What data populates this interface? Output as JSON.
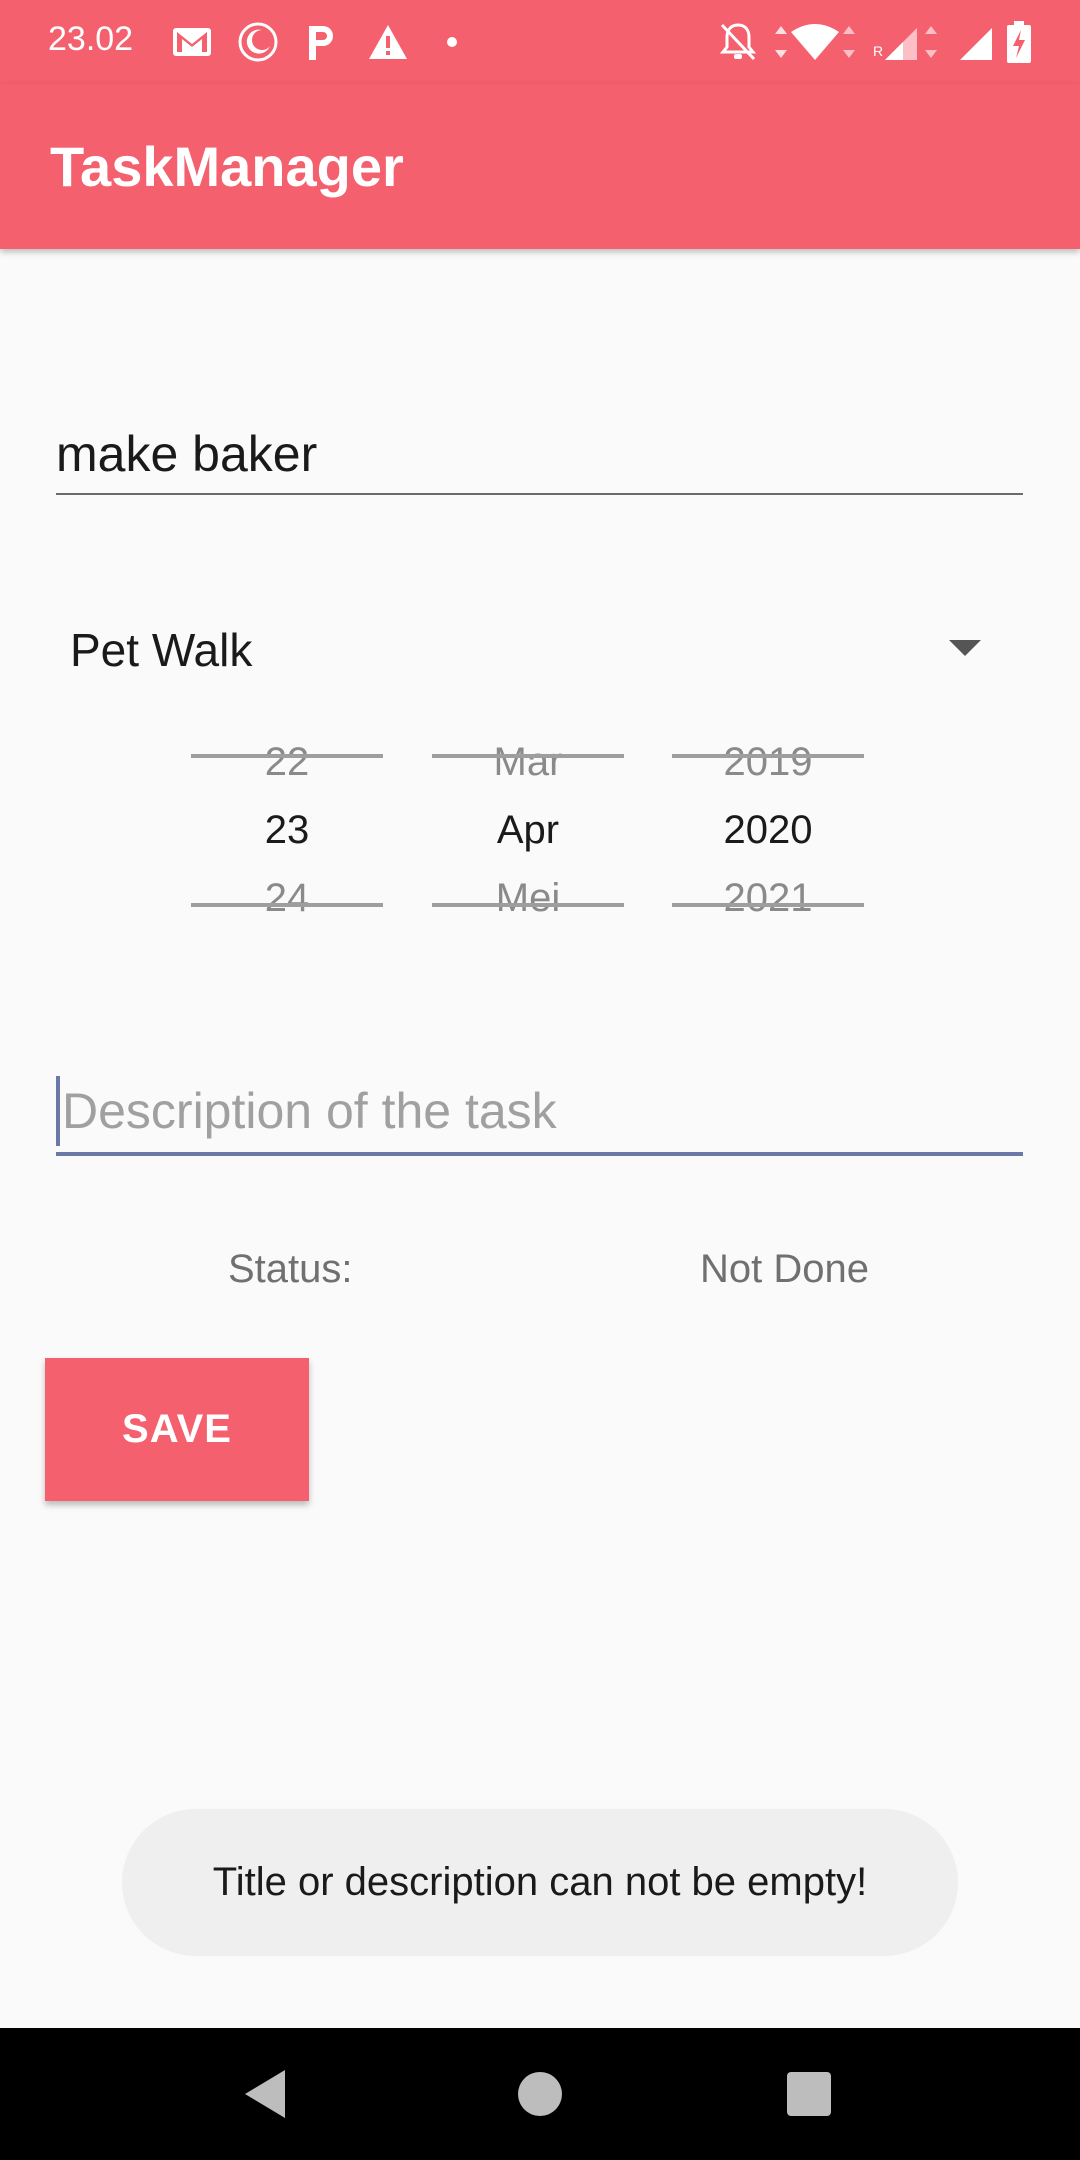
{
  "status_bar": {
    "time": "23.02",
    "left_icons": [
      "gmail-icon",
      "moon-icon",
      "p-icon",
      "warning-icon",
      "dot-icon"
    ],
    "right_icons": [
      "bell-off-icon",
      "wifi-icon",
      "signal-roaming-icon",
      "signal-icon",
      "battery-charging-icon"
    ]
  },
  "app_bar": {
    "title": "TaskManager"
  },
  "form": {
    "title_value": "make baker",
    "category_selected": "Pet Walk",
    "date_picker": {
      "day": {
        "prev": "22",
        "current": "23",
        "next": "24"
      },
      "month": {
        "prev": "Mar",
        "current": "Apr",
        "next": "Mei"
      },
      "year": {
        "prev": "2019",
        "current": "2020",
        "next": "2021"
      }
    },
    "description_placeholder": "Description of the task",
    "description_value": "",
    "status_label": "Status:",
    "status_value": "Not Done",
    "save_label": "SAVE"
  },
  "toast": {
    "message": "Title or description can not be empty!"
  },
  "colors": {
    "accent": "#f4606e",
    "toast_bg": "#efefef",
    "navbar": "#000000"
  },
  "nav_bar": {
    "icons": [
      "back-icon",
      "home-icon",
      "recents-icon"
    ]
  }
}
